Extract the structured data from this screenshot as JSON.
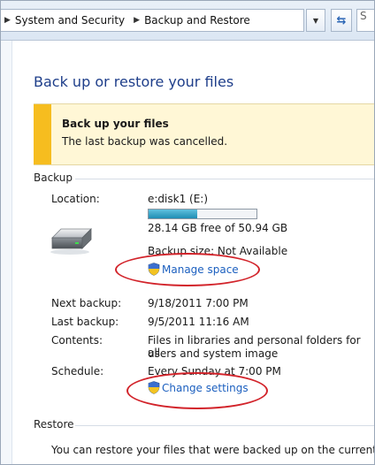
{
  "addressbar": {
    "crumbs": [
      "System and Security",
      "Backup and Restore"
    ],
    "search_fragment": "S"
  },
  "page": {
    "title": "Back up or restore your files"
  },
  "banner": {
    "heading": "Back up your files",
    "message": "The last backup was cancelled."
  },
  "backup": {
    "section_title": "Backup",
    "location_label": "Location:",
    "location_value": "e:disk1 (E:)",
    "free_space": "28.14 GB free of 50.94 GB",
    "used_fraction": 0.448,
    "backup_size": "Backup size: Not Available",
    "manage_space_link": "Manage space",
    "next_label": "Next backup:",
    "next_value": "9/18/2011 7:00 PM",
    "last_label": "Last backup:",
    "last_value": "9/5/2011 11:16 AM",
    "contents_label": "Contents:",
    "contents_line1": "Files in libraries and personal folders for all",
    "contents_line2": "users and system image",
    "schedule_label": "Schedule:",
    "schedule_value": "Every Sunday at 7:00 PM",
    "change_settings_link": "Change settings"
  },
  "restore": {
    "section_title": "Restore",
    "text": "You can restore your files that were backed up on the current"
  },
  "colors": {
    "link": "#1b5fbf",
    "title": "#1e3e8a",
    "banner_bg": "#fff7d6",
    "banner_bar": "#f6bd1f",
    "annotation": "#d2232a"
  }
}
